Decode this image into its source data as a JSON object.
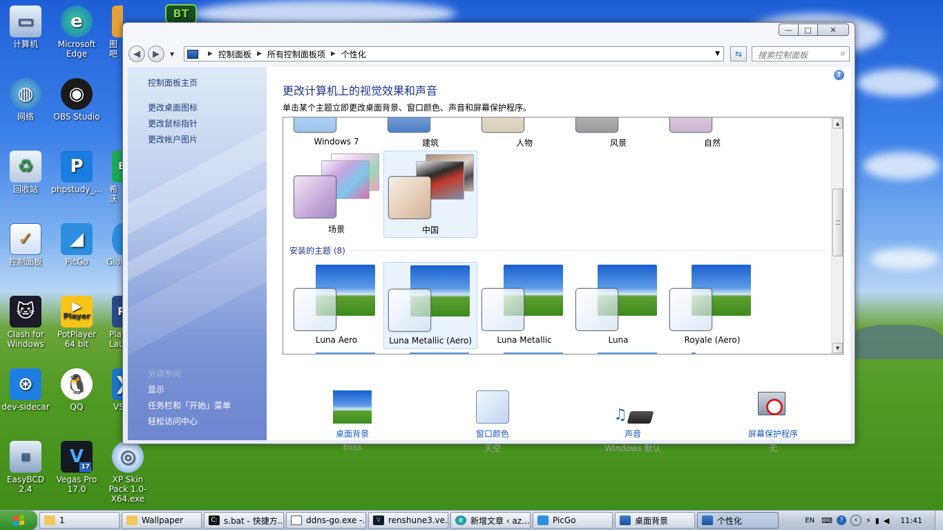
{
  "desktop": {
    "icons": [
      {
        "label": "计算机"
      },
      {
        "label": "Microsoft Edge"
      },
      {
        "label": "图吧"
      },
      {
        "label": "网络"
      },
      {
        "label": "OBS Studio"
      },
      {
        "label": "回收站"
      },
      {
        "label": "phpstudy_..."
      },
      {
        "label": "希沃"
      },
      {
        "label": "控制面板"
      },
      {
        "label": "PicGo"
      },
      {
        "label": "Glou"
      },
      {
        "label": "Clash for Windows"
      },
      {
        "label": "PotPlayer 64 bit"
      },
      {
        "label": "Pla Laun"
      },
      {
        "label": "dev-sidecar"
      },
      {
        "label": "QQ"
      },
      {
        "label": "VS"
      },
      {
        "label": "EasyBCD 2.4"
      },
      {
        "label": "Vegas Pro 17.0"
      },
      {
        "label": "XP Skin Pack 1.0-X64.exe"
      }
    ],
    "potplayer_badge": "Player",
    "vegas_badge": "17",
    "bt_badge": "BT"
  },
  "window": {
    "controls": {
      "minimize": "—",
      "maximize": "□",
      "close": "✕"
    },
    "breadcrumb": [
      "控制面板",
      "所有控制面板项",
      "个性化"
    ],
    "search_placeholder": "搜索控制面板",
    "left_pane": {
      "home_link": "控制面板主页",
      "links": [
        "更改桌面图标",
        "更改鼠标指针",
        "更改帐户图片"
      ],
      "see_also_heading": "另请参阅",
      "see_also": [
        "显示",
        "任务栏和「开始」菜单",
        "轻松访问中心"
      ]
    },
    "title": "更改计算机上的视觉效果和声音",
    "subtitle": "单击某个主题立即更改桌面背景、窗口颜色、声音和屏幕保护程序。",
    "aero_themes_partial": [
      "Windows 7",
      "建筑",
      "人物",
      "风景",
      "自然"
    ],
    "aero_themes_row2": [
      {
        "name": "场景",
        "selected": false
      },
      {
        "name": "中国",
        "selected": true
      }
    ],
    "installed_heading": "安装的主题 (8)",
    "installed_themes": [
      {
        "name": "Luna Aero",
        "selected": false
      },
      {
        "name": "Luna Metallic (Aero)",
        "selected": true
      },
      {
        "name": "Luna Metallic",
        "selected": false
      },
      {
        "name": "Luna",
        "selected": false
      },
      {
        "name": "Royale (Aero)",
        "selected": false
      }
    ],
    "bottom_bar": [
      {
        "link": "桌面背景",
        "value": "bliss"
      },
      {
        "link": "窗口颜色",
        "value": "天空"
      },
      {
        "link": "声音",
        "value": "Windows 默认"
      },
      {
        "link": "屏幕保护程序",
        "value": "无"
      }
    ]
  },
  "taskbar": {
    "tasks": [
      {
        "label": "1"
      },
      {
        "label": "Wallpaper"
      },
      {
        "label": "s.bat - 快捷方..."
      },
      {
        "label": "ddns-go.exe -..."
      },
      {
        "label": "renshune3.ve..."
      },
      {
        "label": "新增文章 ‹ az..."
      },
      {
        "label": "PicGo"
      },
      {
        "label": "桌面背景"
      },
      {
        "label": "个性化"
      }
    ],
    "tray": {
      "lang": "EN",
      "time": "11:41"
    }
  }
}
